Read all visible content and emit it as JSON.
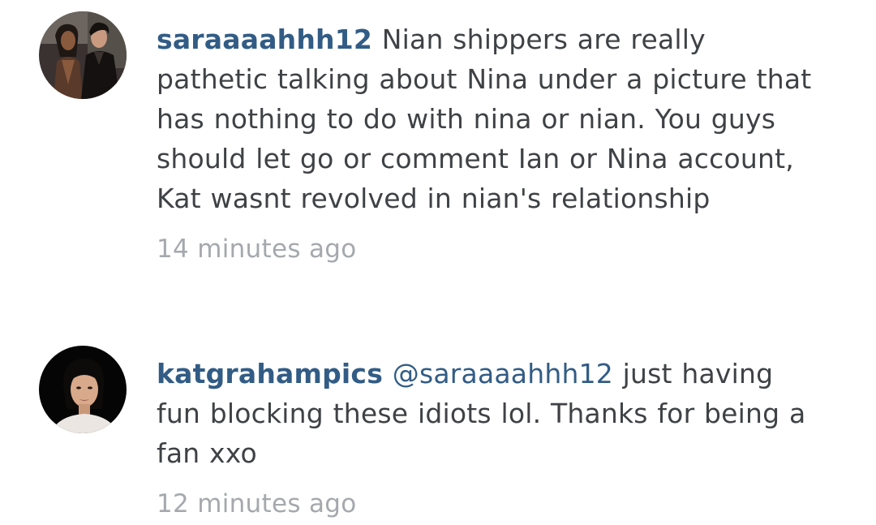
{
  "comments": [
    {
      "username": "saraaaahhh12",
      "mention": "",
      "text": "Nian shippers are really pathetic talking about Nina under a picture that has nothing to do with nina or nian. You guys should let go or comment Ian or Nina account, Kat wasnt revolved in nian's relationship",
      "time": "14 minutes ago"
    },
    {
      "username": "katgrahampics",
      "mention": "@saraaaahhh12",
      "text": "just having fun blocking these idiots lol. Thanks for being a fan xxo",
      "time": "12 minutes ago"
    }
  ],
  "colors": {
    "username": "#325c85",
    "text": "#3f4245",
    "timestamp": "#a5a9ad",
    "background": "#ffffff"
  }
}
